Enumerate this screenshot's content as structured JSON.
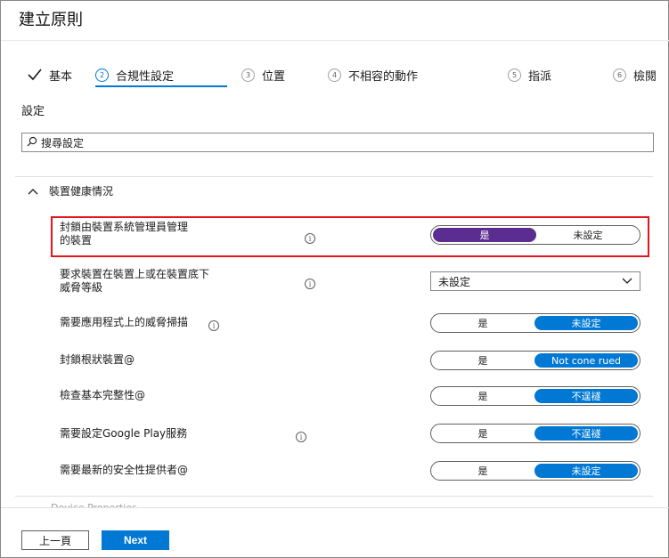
{
  "page": {
    "title": "建立原則"
  },
  "wizard": {
    "steps": [
      {
        "number": "",
        "label": "基本",
        "state": "completed"
      },
      {
        "number": "2",
        "label": "合規性設定",
        "state": "active"
      },
      {
        "number": "3",
        "label": "位置",
        "state": "pending"
      },
      {
        "number": "4",
        "label": "不相容的動作",
        "state": "pending"
      },
      {
        "number": "5",
        "label": "指派",
        "state": "pending"
      },
      {
        "number": "6",
        "label": "檢閱",
        "state": "pending"
      }
    ]
  },
  "settings": {
    "label": "設定",
    "search_placeholder": "搜尋設定"
  },
  "group": {
    "title": "裝置健康情況",
    "expanded": true
  },
  "rows": [
    {
      "label": "封鎖由裝置系統管理員管理的裝置",
      "control": "toggle",
      "yes": "是",
      "no": "未設定",
      "selected": "yes",
      "info": true,
      "highlighted": true
    },
    {
      "label": "要求裝置在裝置上或在裝置底下威脅等級",
      "control": "dropdown",
      "value": "未設定",
      "info": true
    },
    {
      "label": "需要應用程式上的威脅掃描",
      "control": "toggle",
      "yes": "是",
      "no": "未設定",
      "selected": "no",
      "info": true
    },
    {
      "label": "封鎖根狀裝置@",
      "control": "toggle",
      "yes": "是",
      "no": "Not cone rued",
      "selected": "no",
      "info": false
    },
    {
      "label": "檢查基本完整性@",
      "control": "toggle",
      "yes": "是",
      "no": "不逞襚",
      "selected": "no",
      "info": false
    },
    {
      "label": "需要設定Google Play服務",
      "control": "toggle",
      "yes": "是",
      "no": "不逞襚",
      "selected": "no",
      "info": true
    },
    {
      "label": "需要最新的安全性提供者@",
      "control": "toggle",
      "yes": "是",
      "no": "未設定",
      "selected": "no",
      "info": false
    }
  ],
  "next_group_faded": "Device Properties",
  "footer": {
    "prev_label": "上一頁",
    "next_label": "Next"
  },
  "colors": {
    "accent": "#0078d4",
    "selected_purple": "#5c2d91",
    "highlight_border": "#e3141b"
  }
}
